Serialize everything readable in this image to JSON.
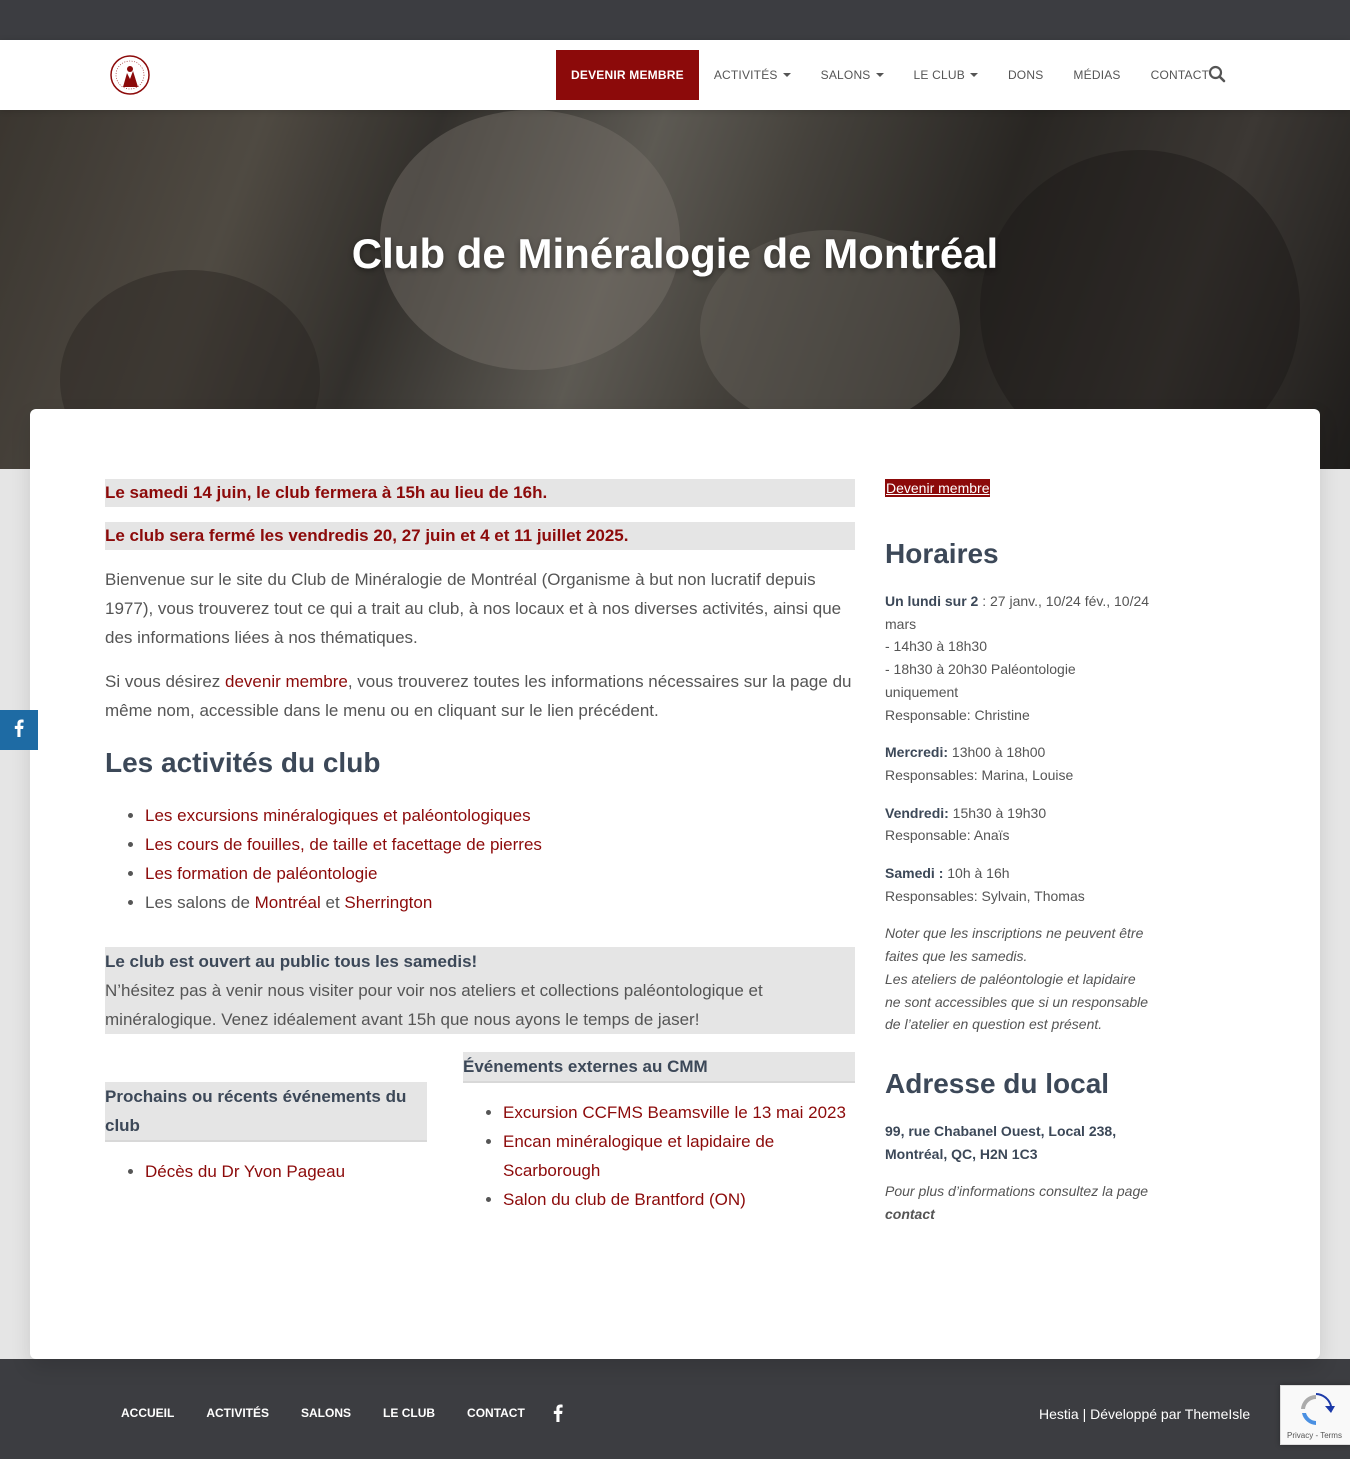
{
  "nav": {
    "items": [
      {
        "label": "DEVENIR MEMBRE",
        "primary": true,
        "dropdown": false
      },
      {
        "label": "ACTIVITÉS",
        "dropdown": true
      },
      {
        "label": "SALONS",
        "dropdown": true
      },
      {
        "label": "LE CLUB",
        "dropdown": true
      },
      {
        "label": "DONS",
        "dropdown": false
      },
      {
        "label": "MÉDIAS",
        "dropdown": false
      },
      {
        "label": "CONTACT",
        "dropdown": false
      }
    ],
    "search_icon": "search-icon"
  },
  "hero": {
    "title": "Club de Minéralogie de Montréal"
  },
  "main": {
    "notice1": "Le samedi 14 juin, le club fermera à 15h au lieu de 16h.",
    "notice2": "Le club sera fermé les vendredis 20, 27 juin et 4 et 11 juillet 2025.",
    "intro": "Bienvenue sur le site du Club de Minéralogie de Montréal (Organisme à but non lucratif depuis 1977), vous trouverez tout ce qui a trait au club, à nos locaux et à nos diverses activités, ainsi que des informations liées à nos thématiques.",
    "member_pre": "Si vous désirez ",
    "member_link": "devenir membre",
    "member_post": ", vous trouverez toutes les informations nécessaires sur la page du même nom, accessible dans le menu ou en cliquant sur le lien précédent.",
    "activities_title": "Les activités du club",
    "activities": [
      "Les excursions minéralogiques et paléontologiques",
      "Les cours de fouilles, de taille et facettage de pierres",
      "Les formation de paléontologie"
    ],
    "salons_pre": "Les salons de ",
    "salons_link1": "Montréal",
    "salons_mid": " et ",
    "salons_link2": "Sherrington",
    "open_title": "Le club est ouvert au public tous les samedis!",
    "open_text": "N’hésitez pas à venir nous visiter pour voir nos ateliers et collections paléontologique et minéralogique. Venez idéalement avant 15h que nous ayons le temps de jaser!",
    "club_events_title": "Prochains ou récents événements du club",
    "club_events": [
      "Décès du Dr Yvon Pageau"
    ],
    "external_title": "Événements externes au CMM",
    "external_events": [
      "Excursion CCFMS Beamsville le 13 mai 2023",
      "Encan minéralogique et lapidaire de Scarborough",
      "Salon du club de Brantford (ON)"
    ]
  },
  "sidebar": {
    "button": "Devenir membre",
    "hours_title": "Horaires",
    "monday_label": "Un lundi sur 2",
    "monday_text": " : 27 janv., 10/24 fév., 10/24 mars",
    "monday_line1": "- 14h30 à 18h30",
    "monday_line2": "- 18h30 à 20h30 Paléontologie uniquement",
    "monday_resp": "Responsable: Christine",
    "wednesday_label": "Mercredi:",
    "wednesday_text": " 13h00 à 18h00",
    "wednesday_resp": "Responsables: Marina, Louise",
    "friday_label": "Vendredi:",
    "friday_text": " 15h30 à 19h30",
    "friday_resp": "Responsable: Anaïs",
    "saturday_label": "Samedi :",
    "saturday_text": " 10h à 16h",
    "saturday_resp": "Responsables: Sylvain, Thomas",
    "note1": "Noter que les inscriptions ne peuvent être faites que les samedis.",
    "note2": "Les ateliers de paléontologie et lapidaire ne sont accessibles que si un responsable de l’atelier en question est présent.",
    "address_title": "Adresse du local",
    "address_line1": "99, rue Chabanel Ouest, Local 238,",
    "address_line2": "Montréal, QC, H2N 1C3",
    "info_pre": "Pour plus d’informations consultez la page ",
    "info_link": "contact"
  },
  "footer": {
    "items": [
      "ACCUEIL",
      "ACTIVITÉS",
      "SALONS",
      "LE CLUB",
      "CONTACT"
    ],
    "credit_pre": "Hestia | Développé par ",
    "credit_link": "ThemeIsle"
  },
  "recaptcha": {
    "links": "Privacy - Terms"
  },
  "colors": {
    "accent": "#8c0a0a",
    "dark": "#3c3d41",
    "facebook": "#1e6ba4"
  }
}
